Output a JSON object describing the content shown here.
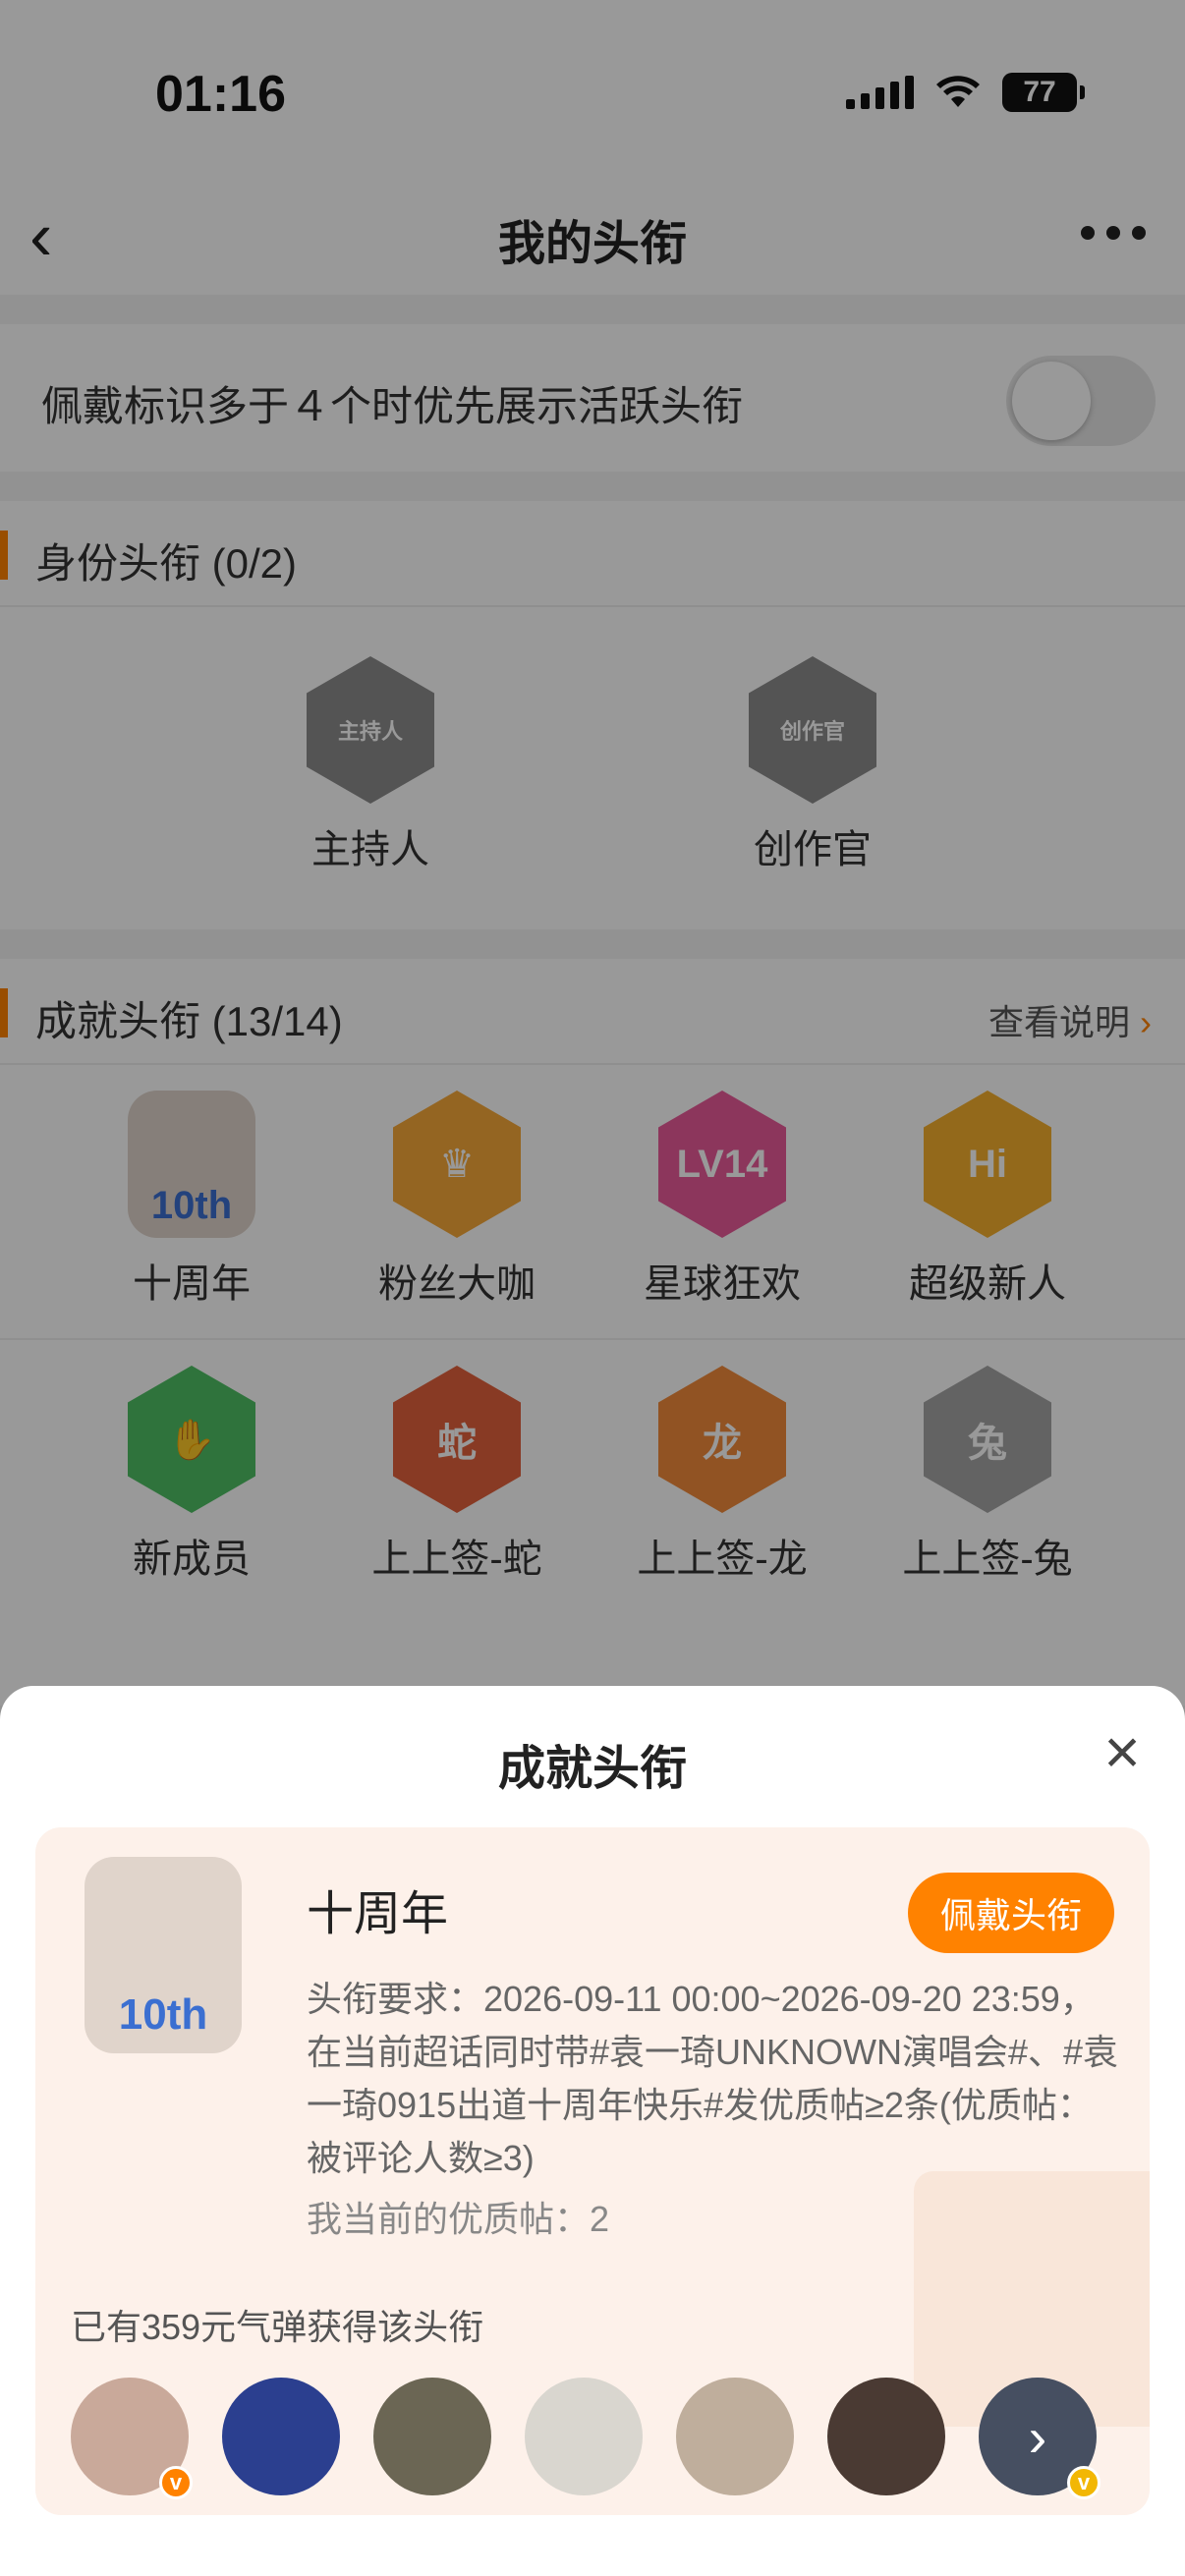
{
  "status": {
    "time": "01:16",
    "battery": "77"
  },
  "nav": {
    "title": "我的头衔"
  },
  "toggle_row": {
    "label": "佩戴标识多于４个时优先展示活跃头衔",
    "enabled": false
  },
  "identity": {
    "title": "身份头衔 (0/2)",
    "items": [
      {
        "name": "主持人",
        "icon": "microphone-badge-icon",
        "hex_text": "主持人"
      },
      {
        "name": "创作官",
        "icon": "creator-hand-badge-icon",
        "hex_text": "创作官"
      }
    ]
  },
  "achievement": {
    "title": "成就头衔 (13/14)",
    "link": "查看说明",
    "items": [
      {
        "name": "十周年",
        "icon": "tenth-anniversary-girl-icon",
        "hex_text": "10th"
      },
      {
        "name": "粉丝大咖",
        "icon": "crown-badge-icon",
        "hex_text": "♛"
      },
      {
        "name": "星球狂欢",
        "icon": "lv14-badge-icon",
        "hex_text": "LV14"
      },
      {
        "name": "超级新人",
        "icon": "hi-badge-icon",
        "hex_text": "Hi"
      },
      {
        "name": "新成员",
        "icon": "hand-wave-badge-icon",
        "hex_text": "✋"
      },
      {
        "name": "上上签-蛇",
        "icon": "snake-badge-icon",
        "hex_text": "蛇"
      },
      {
        "name": "上上签-龙",
        "icon": "dragon-badge-icon",
        "hex_text": "龙"
      },
      {
        "name": "上上签-兔",
        "icon": "rabbit-badge-icon",
        "hex_text": "兔"
      }
    ]
  },
  "sheet": {
    "title": "成就头衔",
    "card": {
      "name": "十周年",
      "illus_text": "10th",
      "wear_label": "佩戴头衔",
      "requirement": "头衔要求：2026-09-11 00:00~2026-09-20 23:59，在当前超话同时带#袁一琦UNKNOWN演唱会#、#袁一琦0915出道十周年快乐#发优质帖≥2条(优质帖：被评论人数≥3)",
      "my_posts": "我当前的优质帖：2",
      "holders": "已有359元气弹获得该头衔",
      "avatars": [
        {
          "color": "#c9a99a",
          "badge": "orange"
        },
        {
          "color": "#2b3f8f",
          "badge": ""
        },
        {
          "color": "#6b6654",
          "badge": ""
        },
        {
          "color": "#d9d6cf",
          "badge": ""
        },
        {
          "color": "#bfae9c",
          "badge": ""
        },
        {
          "color": "#4a3a33",
          "badge": ""
        },
        {
          "color": "#6c7a96",
          "badge": "gold"
        }
      ]
    }
  }
}
